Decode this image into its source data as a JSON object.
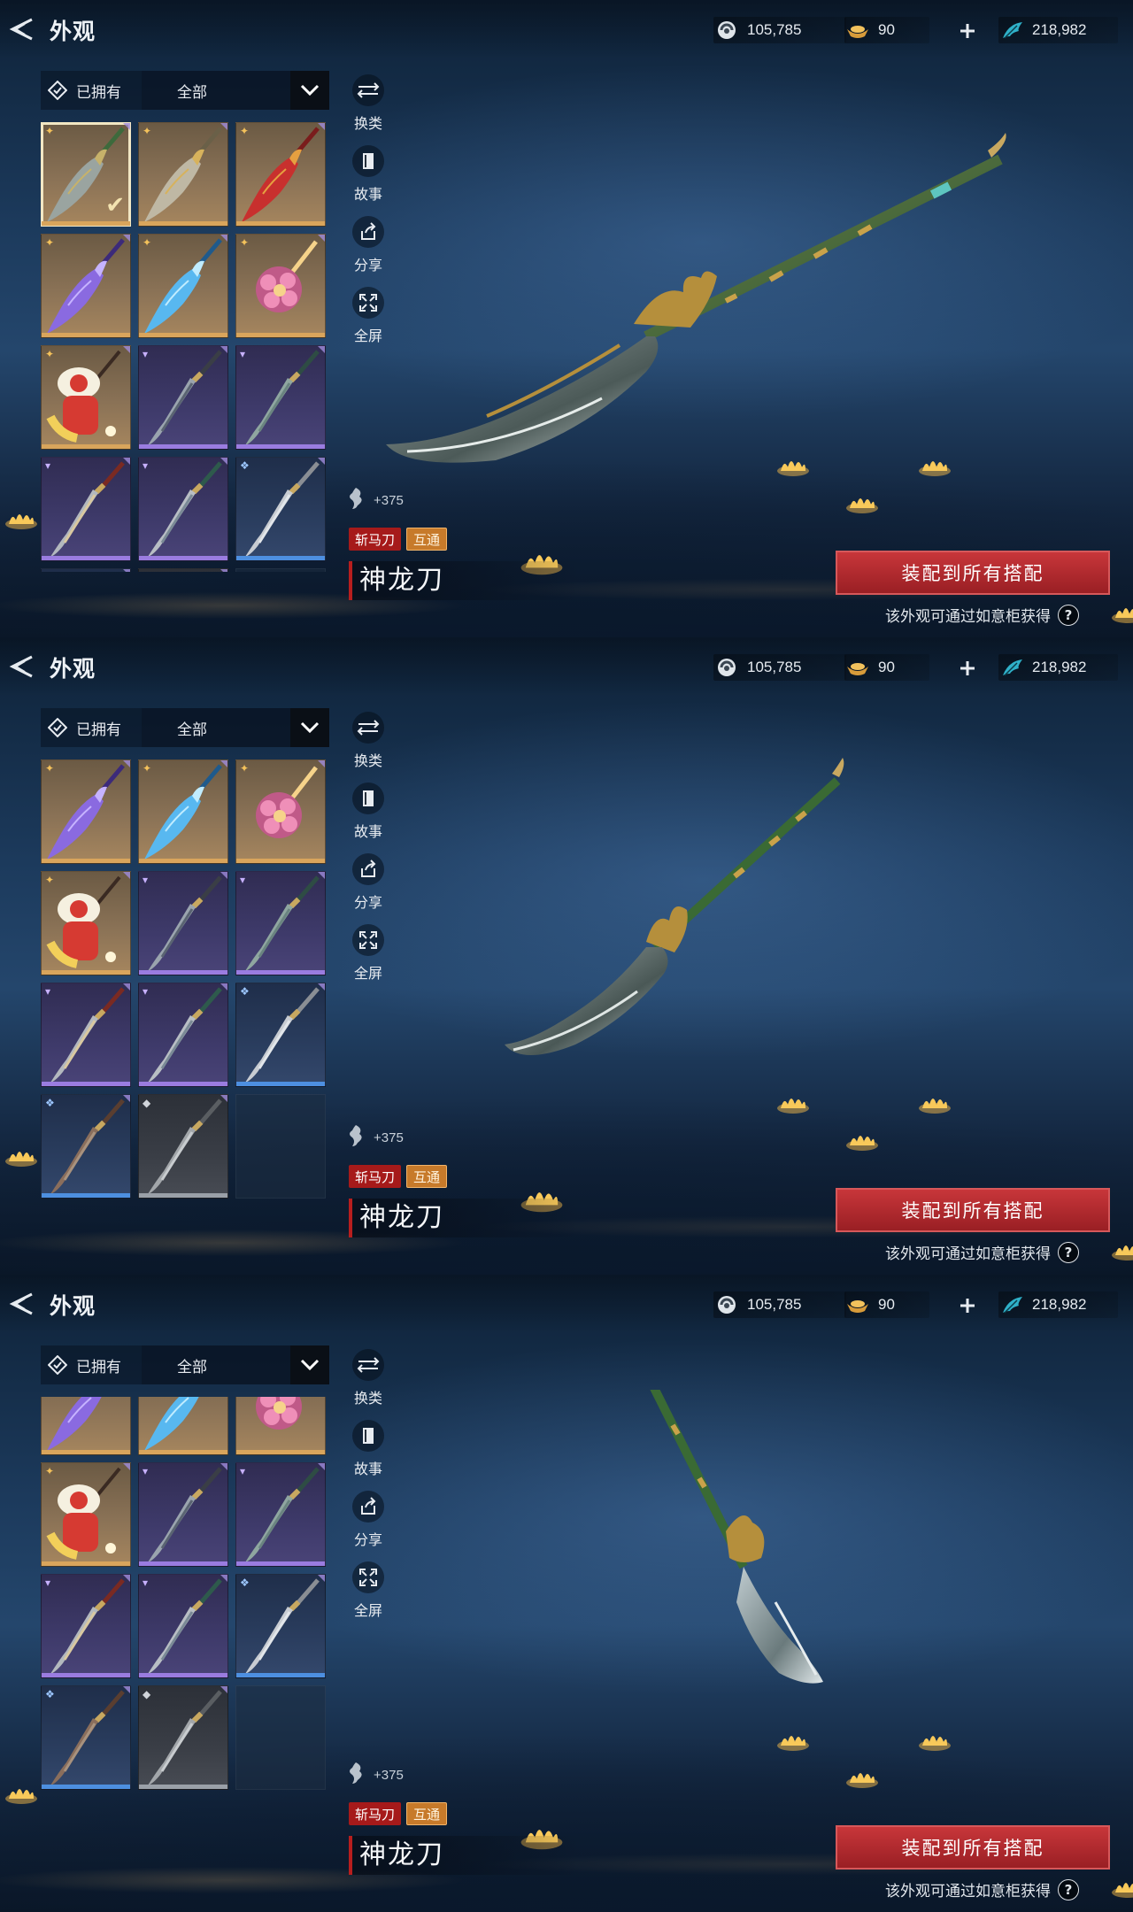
{
  "frames": [
    {
      "title": "外观",
      "currencies": [
        {
          "icon": "jade-coin-icon",
          "value": "105,785"
        },
        {
          "icon": "gold-ingot-icon",
          "value": "90"
        },
        {
          "icon": "feather-token-icon",
          "value": "218,982"
        }
      ],
      "filter": {
        "owned_label": "已拥有",
        "category_value": "全部"
      },
      "tools": [
        {
          "icon": "swap-weapon-icon",
          "label": "换类"
        },
        {
          "icon": "story-book-icon",
          "label": "故事"
        },
        {
          "icon": "share-icon",
          "label": "分享"
        },
        {
          "icon": "fullscreen-icon",
          "label": "全屏"
        }
      ],
      "power": "+375",
      "tags": [
        "斩马刀",
        "互通"
      ],
      "item_name": "神龙刀",
      "equip_label": "装配到所有搭配",
      "obtain_hint": "该外观可通过如意柜获得",
      "help_glyph": "?"
    },
    {
      "title": "外观",
      "currencies": [
        {
          "icon": "jade-coin-icon",
          "value": "105,785"
        },
        {
          "icon": "gold-ingot-icon",
          "value": "90"
        },
        {
          "icon": "feather-token-icon",
          "value": "218,982"
        }
      ],
      "filter": {
        "owned_label": "已拥有",
        "category_value": "全部"
      },
      "tools": [
        {
          "icon": "swap-weapon-icon",
          "label": "换类"
        },
        {
          "icon": "story-book-icon",
          "label": "故事"
        },
        {
          "icon": "share-icon",
          "label": "分享"
        },
        {
          "icon": "fullscreen-icon",
          "label": "全屏"
        }
      ],
      "power": "+375",
      "tags": [
        "斩马刀",
        "互通"
      ],
      "item_name": "神龙刀",
      "equip_label": "装配到所有搭配",
      "obtain_hint": "该外观可通过如意柜获得",
      "help_glyph": "?"
    },
    {
      "title": "外观",
      "currencies": [
        {
          "icon": "jade-coin-icon",
          "value": "105,785"
        },
        {
          "icon": "gold-ingot-icon",
          "value": "90"
        },
        {
          "icon": "feather-token-icon",
          "value": "218,982"
        }
      ],
      "filter": {
        "owned_label": "已拥有",
        "category_value": "全部"
      },
      "tools": [
        {
          "icon": "swap-weapon-icon",
          "label": "换类"
        },
        {
          "icon": "story-book-icon",
          "label": "故事"
        },
        {
          "icon": "share-icon",
          "label": "分享"
        },
        {
          "icon": "fullscreen-icon",
          "label": "全屏"
        }
      ],
      "power": "+375",
      "tags": [
        "斩马刀",
        "互通"
      ],
      "item_name": "神龙刀",
      "equip_label": "装配到所有搭配",
      "obtain_hint": "该外观可通过如意柜获得",
      "help_glyph": "?"
    }
  ],
  "grid_items": [
    {
      "rarity": "gold",
      "art": "guandao-dragon-green",
      "selected": true
    },
    {
      "rarity": "gold",
      "art": "guandao-gold-hook"
    },
    {
      "rarity": "gold",
      "art": "guandao-red-flame"
    },
    {
      "rarity": "gold",
      "art": "blade-purple-crystal"
    },
    {
      "rarity": "gold",
      "art": "blade-blue-ice"
    },
    {
      "rarity": "gold",
      "art": "staff-pink-flower"
    },
    {
      "rarity": "gold",
      "art": "lion-dance-mallet"
    },
    {
      "rarity": "purple",
      "art": "dao-dark-blade"
    },
    {
      "rarity": "purple",
      "art": "dao-jade-blade"
    },
    {
      "rarity": "purple",
      "art": "dao-red-pattern"
    },
    {
      "rarity": "purple",
      "art": "dao-green-hilt"
    },
    {
      "rarity": "blue",
      "art": "dao-curved-silver"
    },
    {
      "rarity": "blue",
      "art": "dao-rust-brown"
    },
    {
      "rarity": "grey",
      "art": "dao-plain-iron"
    },
    {
      "rarity": "empty",
      "art": ""
    }
  ],
  "colors": {
    "rarity_gold": "#d9a55c",
    "rarity_purple": "#9a7ce0",
    "rarity_blue": "#4d8fe0",
    "rarity_grey": "#9aa0a8",
    "equip_button": "#b52a2f",
    "tag_type": "#a61a1a",
    "tag_shared": "#c77a2a"
  }
}
